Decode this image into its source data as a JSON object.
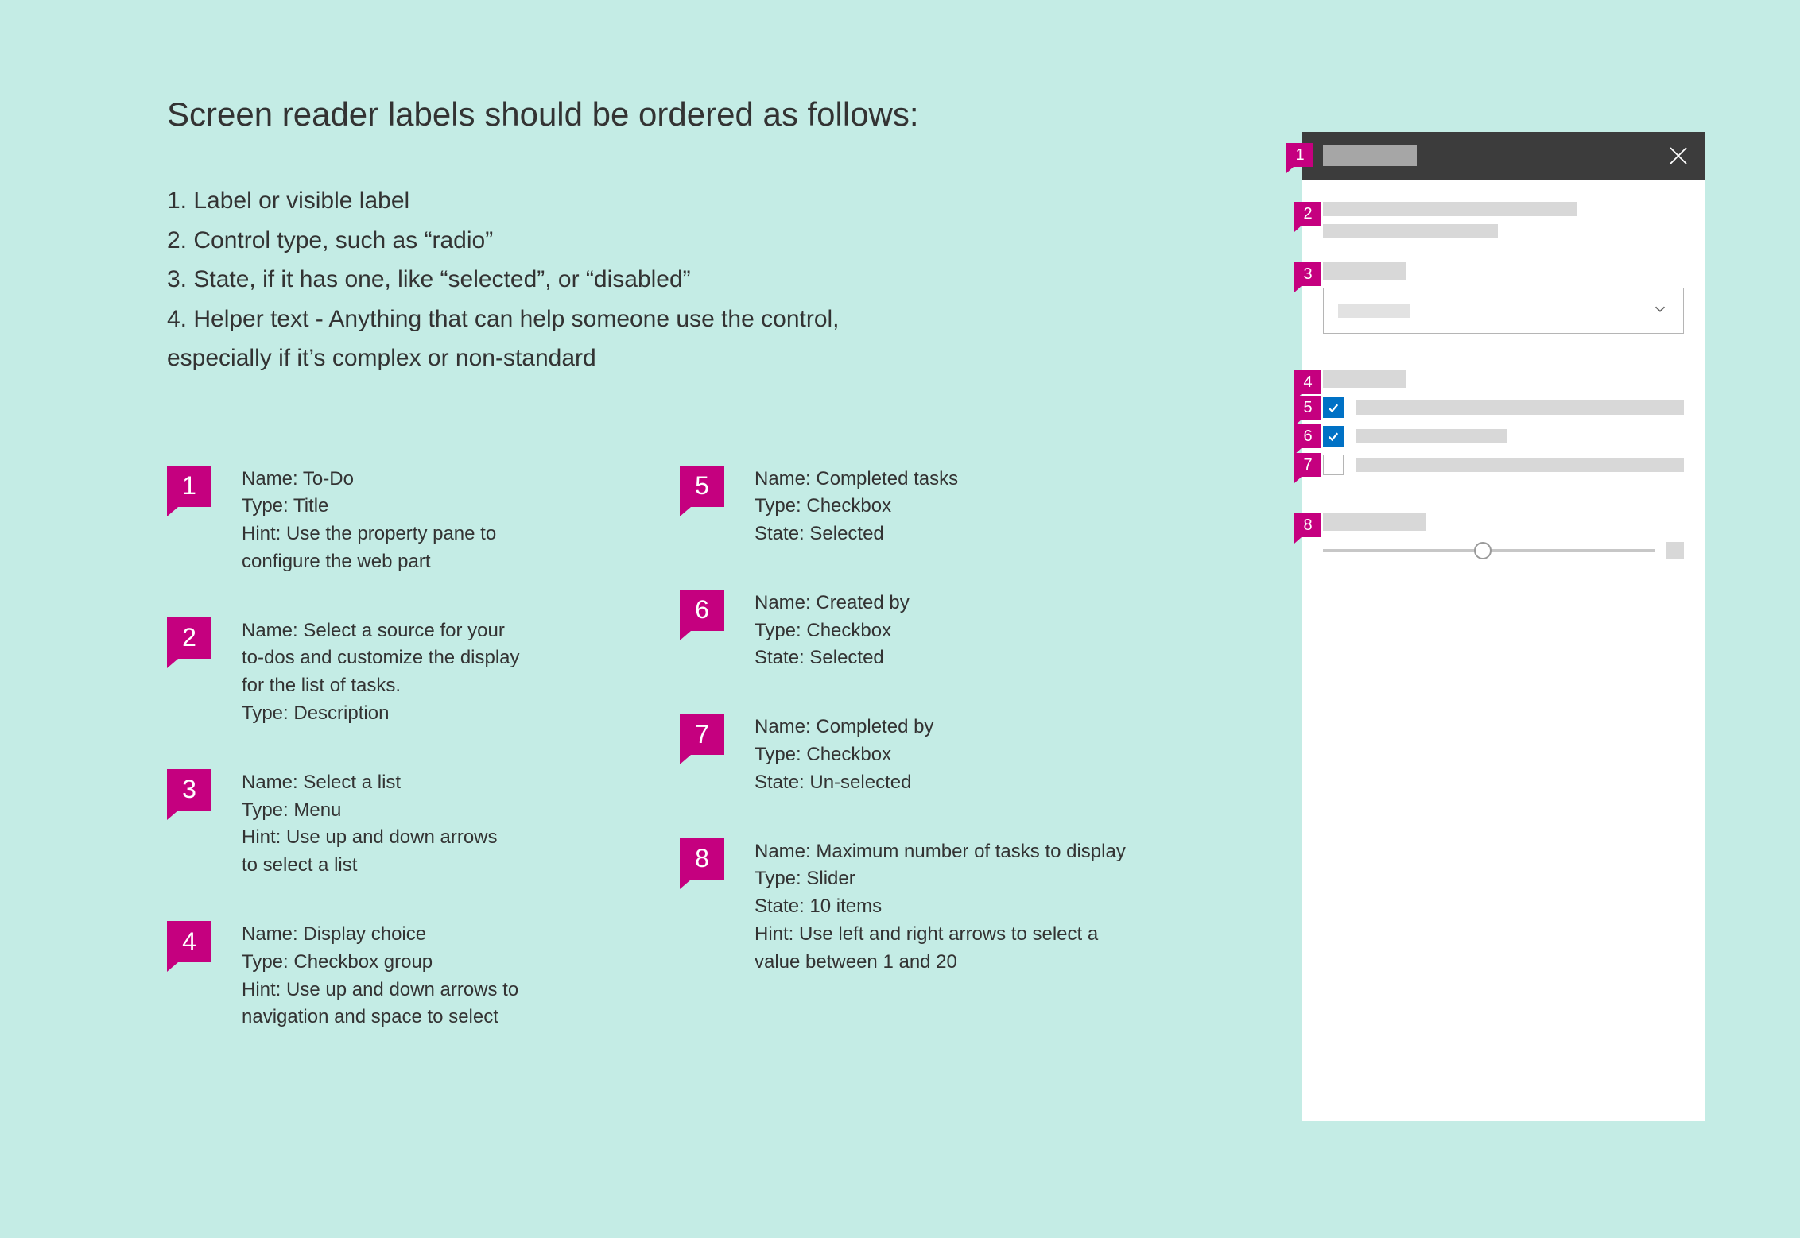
{
  "heading": "Screen reader labels should be ordered as follows:",
  "guidelines": {
    "g1": "1. Label or visible label",
    "g2": "2. Control type, such as “radio”",
    "g3": "3. State, if it has one, like “selected”, or “disabled”",
    "g4a": "4. Helper text - Anything that can help someone use the control,",
    "g4b": "especially if it’s complex or non-standard"
  },
  "callout_numbers": {
    "n1": "1",
    "n2": "2",
    "n3": "3",
    "n4": "4",
    "n5": "5",
    "n6": "6",
    "n7": "7",
    "n8": "8"
  },
  "items": {
    "i1": {
      "l1": "Name: To-Do",
      "l2": "Type: Title",
      "l3": "Hint: Use the property pane to",
      "l4": "configure the web part"
    },
    "i2": {
      "l1": "Name: Select a source for your",
      "l2": "to-dos and customize the display",
      "l3": "for the list of tasks.",
      "l4": "Type: Description"
    },
    "i3": {
      "l1": "Name: Select a list",
      "l2": "Type: Menu",
      "l3": "Hint: Use up and down arrows",
      "l4": "to select a list"
    },
    "i4": {
      "l1": "Name: Display choice",
      "l2": "Type: Checkbox group",
      "l3": "Hint: Use up and down arrows to",
      "l4": "navigation and space to select"
    },
    "i5": {
      "l1": "Name: Completed tasks",
      "l2": "Type: Checkbox",
      "l3": "State: Selected"
    },
    "i6": {
      "l1": "Name: Created by",
      "l2": "Type: Checkbox",
      "l3": "State: Selected"
    },
    "i7": {
      "l1": "Name: Completed  by",
      "l2": "Type: Checkbox",
      "l3": "State: Un-selected"
    },
    "i8": {
      "l1": "Name: Maximum number of tasks to display",
      "l2": "Type: Slider",
      "l3": "State: 10 items",
      "l4": "Hint: Use left and right arrows to select a",
      "l5": "value between 1 and 20"
    }
  }
}
